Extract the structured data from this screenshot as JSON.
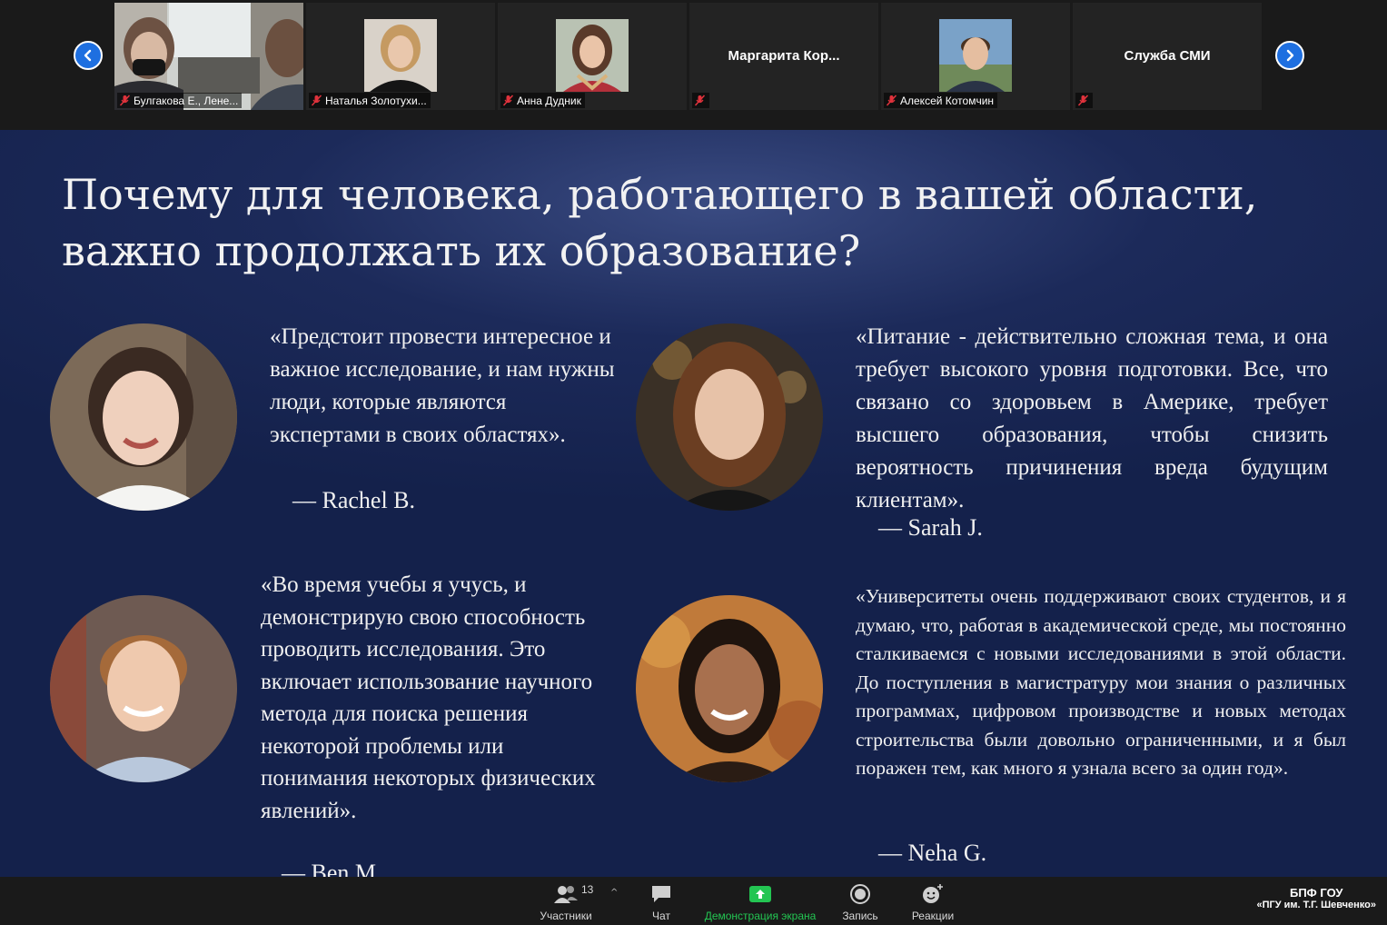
{
  "participants": {
    "count": "13",
    "tiles": [
      {
        "name": "Булгакова Е., Лене..."
      },
      {
        "name": "Наталья Золотухи..."
      },
      {
        "name": "Анна Дудник"
      },
      {
        "name": "",
        "display_name": "Маргарита  Кор..."
      },
      {
        "name": "Алексей Котомчин"
      },
      {
        "name": "",
        "display_name": "Служба СМИ"
      }
    ]
  },
  "slide": {
    "title": "Почему для человека, работающего в вашей области, важно продолжать их образование?",
    "quotes": [
      {
        "text": "«Предстоит провести интересное и важное исследование, и нам нужны люди, которые являются экспертами в своих областях».",
        "author": "—   Rachel B."
      },
      {
        "text": "«Питание - действительно сложная тема, и она требует высокого уровня подготовки. Все, что связано со здоровьем в Америке, требует высшего образования, чтобы снизить вероятность причинения вреда будущим клиентам».",
        "author": "—   Sarah J."
      },
      {
        "text": "«Во время учебы я учусь, и демонстрирую свою способность проводить исследования. Это включает использование научного метода для поиска решения некоторой проблемы или понимания некоторых физических явлений».",
        "author": "—   Ben M."
      },
      {
        "text": "«Университеты очень поддерживают своих студентов, и я думаю, что, работая в академической среде, мы постоянно сталкиваемся с новыми исследованиями в этой области. До поступления в магистратуру мои знания о различных программах, цифровом производстве и новых методах строительства были довольно ограниченными, и я был поражен тем, как много я узнала всего за один год».",
        "author": "—   Neha G."
      }
    ]
  },
  "toolbar": {
    "participants_label": "Участники",
    "chat_label": "Чат",
    "share_label": "Демонстрация экрана",
    "record_label": "Запись",
    "reactions_label": "Реакции"
  },
  "watermark": {
    "line1": "БПФ ГОУ",
    "line2": "«ПГУ им. Т.Г. Шевченко»"
  },
  "colors": {
    "nav_button": "#1e6fe0",
    "share_green": "#23c552",
    "mute_red": "#e0323c",
    "slide_bg": "#14214b"
  },
  "icons": [
    "chevron-left-icon",
    "chevron-right-icon",
    "mic-muted-icon",
    "participants-icon",
    "chat-icon",
    "share-screen-icon",
    "record-icon",
    "reactions-icon"
  ]
}
